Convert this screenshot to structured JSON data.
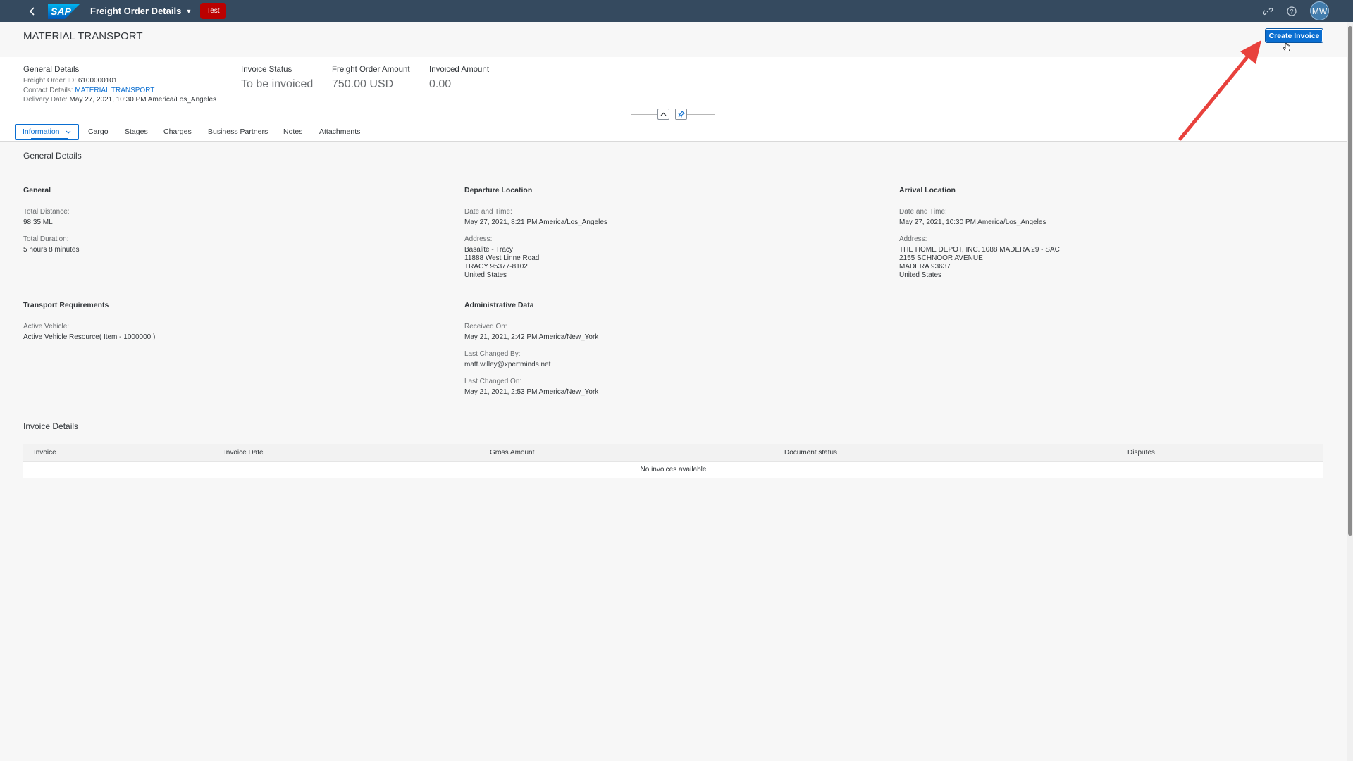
{
  "shell": {
    "logo_text": "SAP",
    "app_title": "Freight Order Details",
    "env_badge": "Test",
    "user_initials": "MW",
    "colors": {
      "shell_bg": "#354a5f",
      "env_badge": "#bb0000",
      "accent": "#0a6ed1"
    }
  },
  "header": {
    "title": "MATERIAL TRANSPORT",
    "create_invoice_label": "Create Invoice",
    "general_details_title": "General Details",
    "freight_order_id_label": "Freight Order ID:",
    "freight_order_id": "6100000101",
    "contact_details_label": "Contact Details:",
    "contact_details": "MATERIAL TRANSPORT",
    "delivery_date_label": "Delivery Date:",
    "delivery_date": "May 27, 2021, 10:30 PM America/Los_Angeles",
    "kpis": [
      {
        "title": "Invoice Status",
        "value": "To be invoiced"
      },
      {
        "title": "Freight Order Amount",
        "value": "750.00 USD"
      },
      {
        "title": "Invoiced Amount",
        "value": "0.00"
      }
    ]
  },
  "tabs": [
    {
      "label": "Information",
      "active": true
    },
    {
      "label": "Cargo"
    },
    {
      "label": "Stages"
    },
    {
      "label": "Charges"
    },
    {
      "label": "Business Partners"
    },
    {
      "label": "Notes"
    },
    {
      "label": "Attachments"
    }
  ],
  "general_details": {
    "section_title": "General Details",
    "general": {
      "title": "General",
      "total_distance_label": "Total Distance:",
      "total_distance": "98.35 ML",
      "total_duration_label": "Total Duration:",
      "total_duration": "5 hours 8 minutes"
    },
    "departure": {
      "title": "Departure Location",
      "datetime_label": "Date and Time:",
      "datetime": "May 27, 2021, 8:21 PM America/Los_Angeles",
      "address_label": "Address:",
      "address_lines": [
        "Basalite - Tracy",
        "11888 West Linne Road",
        "TRACY 95377-8102",
        "United States"
      ]
    },
    "arrival": {
      "title": "Arrival Location",
      "datetime_label": "Date and Time:",
      "datetime": "May 27, 2021, 10:30 PM America/Los_Angeles",
      "address_label": "Address:",
      "address_lines": [
        "THE HOME DEPOT, INC. 1088 MADERA 29 - SAC",
        "2155 SCHNOOR AVENUE",
        "MADERA 93637",
        "United States"
      ]
    },
    "transport": {
      "title": "Transport Requirements",
      "active_vehicle_label": "Active Vehicle:",
      "active_vehicle": "Active Vehicle Resource( Item - 1000000 )"
    },
    "admin": {
      "title": "Administrative Data",
      "received_on_label": "Received On:",
      "received_on": "May 21, 2021, 2:42 PM America/New_York",
      "last_changed_by_label": "Last Changed By:",
      "last_changed_by": "matt.willey@xpertminds.net",
      "last_changed_on_label": "Last Changed On:",
      "last_changed_on": "May 21, 2021, 2:53 PM America/New_York"
    }
  },
  "invoice_details": {
    "section_title": "Invoice Details",
    "columns": [
      "Invoice",
      "Invoice Date",
      "Gross Amount",
      "Document status",
      "Disputes"
    ],
    "empty_text": "No invoices available"
  }
}
